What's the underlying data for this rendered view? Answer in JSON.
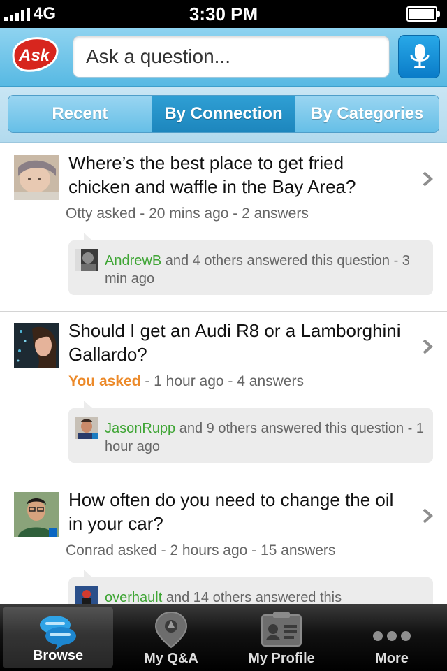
{
  "status_bar": {
    "carrier": "4G",
    "time": "3:30 PM"
  },
  "header": {
    "logo_text": "Ask",
    "search_placeholder": "Ask a question...",
    "mic_icon": "microphone-icon"
  },
  "tabs": [
    {
      "label": "Recent",
      "active": false
    },
    {
      "label": "By Connection",
      "active": true
    },
    {
      "label": "By Categories",
      "active": false
    }
  ],
  "feed": [
    {
      "question": "Where’s the best place to get fried chicken and waffle in the Bay Area?",
      "asker": "Otty asked",
      "time": "20 mins ago",
      "answers": "2 answers",
      "answerer": "AndrewB",
      "answer_summary": "and 4 others answered this question - 3 min ago"
    },
    {
      "question": "Should I get an Audi R8 or a Lamborghini Gallardo?",
      "asker": "You asked",
      "time": "1 hour ago",
      "answers": "4 answers",
      "answerer": "JasonRupp",
      "answer_summary": "and 9 others answered this question - 1 hour ago"
    },
    {
      "question": "How often do you need to change the oil in your car?",
      "asker": "Conrad asked",
      "time": "2 hours ago",
      "answers": "15 answers",
      "answerer": "overhault",
      "answer_summary": "and 14 others answered this"
    }
  ],
  "bottom_tabs": [
    {
      "label": "Browse",
      "icon": "speech-bubbles-icon",
      "active": true
    },
    {
      "label": "My Q&A",
      "icon": "lightbulb-pin-icon",
      "active": false
    },
    {
      "label": "My Profile",
      "icon": "profile-card-icon",
      "active": false
    },
    {
      "label": "More",
      "icon": "more-dots-icon",
      "active": false
    }
  ],
  "colors": {
    "accent_blue": "#1d86bd",
    "you_asked": "#ec8a2a",
    "answerer_name": "#3fa535",
    "logo_red": "#d7261e"
  }
}
